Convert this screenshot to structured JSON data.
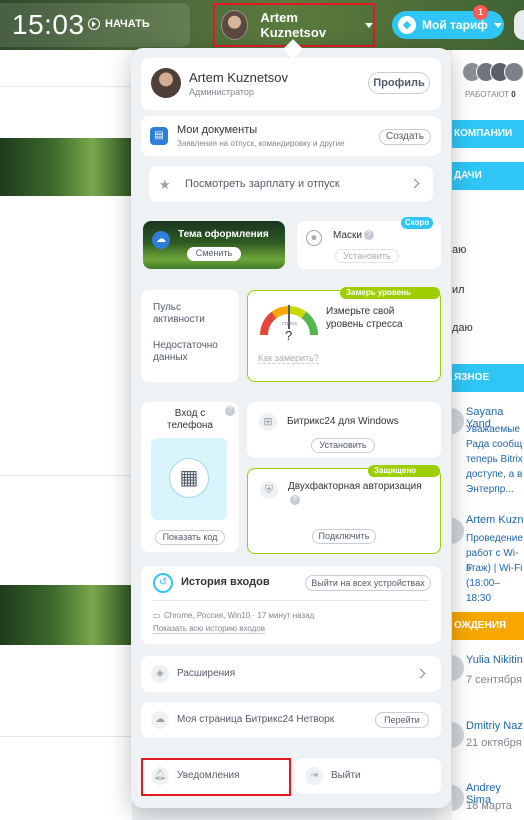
{
  "topbar": {
    "time": "15:03",
    "start_label": "НАЧАТЬ",
    "user_name": "Artem Kuznetsov",
    "tariff_label": "Мой тариф",
    "tariff_badge": "1"
  },
  "background": {
    "right_column": {
      "works_label": "РАБОТАЮТ",
      "works_count": "0",
      "company_header": "КОМПАНИИ",
      "tasks_header": "ДАЧИ",
      "task_lines": [
        "аю",
        "ил",
        "даю"
      ],
      "important_header": "ЯЗНОЕ",
      "post1_name": "Sayana Yand",
      "post1_text": [
        "Уважаемые",
        "Рада сообщ",
        "теперь Bitrix",
        "доступе, а в",
        "Энтерпр..."
      ],
      "post2_name": "Artem Kuzn",
      "post2_text": [
        "Проведение",
        "работ с Wi-F",
        "этаж) | Wi-Fi",
        "(18:00–18:30"
      ],
      "birthdays_header": "ОЖДЕНИЯ",
      "birthdays": [
        {
          "name": "Yulia Nikitin",
          "date": "7 сентября"
        },
        {
          "name": "Dmitriy Naz",
          "date": "21 октября"
        },
        {
          "name": "Andrey Sima",
          "date": "18 марта"
        }
      ]
    }
  },
  "menu": {
    "profile": {
      "name": "Artem Kuznetsov",
      "role": "Администратор",
      "button": "Профиль"
    },
    "documents": {
      "title": "Мои документы",
      "subtitle": "Заявления на отпуск, командировку и другие",
      "button": "Создать"
    },
    "salary": {
      "label": "Посмотреть зарплату и отпуск"
    },
    "theme": {
      "title": "Тема оформления",
      "button": "Сменить"
    },
    "masks": {
      "title": "Маски",
      "badge": "Скоро",
      "button": "Установить"
    },
    "pulse": {
      "title": "Пульс активности",
      "status": "Недостаточно данных"
    },
    "stress": {
      "badge": "Замерь уровень стресса",
      "gauge_label": "стресс",
      "gauge_value": "?",
      "text": "Измерьте свой уровень стресса",
      "link": "Как замерить?"
    },
    "phone_login": {
      "title": "Вход с телефона",
      "button": "Показать код"
    },
    "windows_app": {
      "title": "Битрикс24 для Windows",
      "button": "Установить"
    },
    "two_factor": {
      "badge": "Защищено OTP",
      "title": "Двухфакторная авторизация",
      "button": "Подключить"
    },
    "login_history": {
      "title": "История входов",
      "button": "Выйти на всех устройствах",
      "entry": "Chrome, Россия, Win10 · 17 минут назад",
      "link": "Показать всю историю входов"
    },
    "extensions": {
      "label": "Расширения"
    },
    "network": {
      "label": "Моя страница Битрикс24 Нетворк",
      "button": "Перейти"
    },
    "notifications": {
      "label": "Уведомления"
    },
    "logout": {
      "label": "Выйти"
    }
  },
  "colors": {
    "accent_blue": "#2fc6f6",
    "accent_green": "#9dcf00",
    "highlight_red": "#e21b23"
  }
}
